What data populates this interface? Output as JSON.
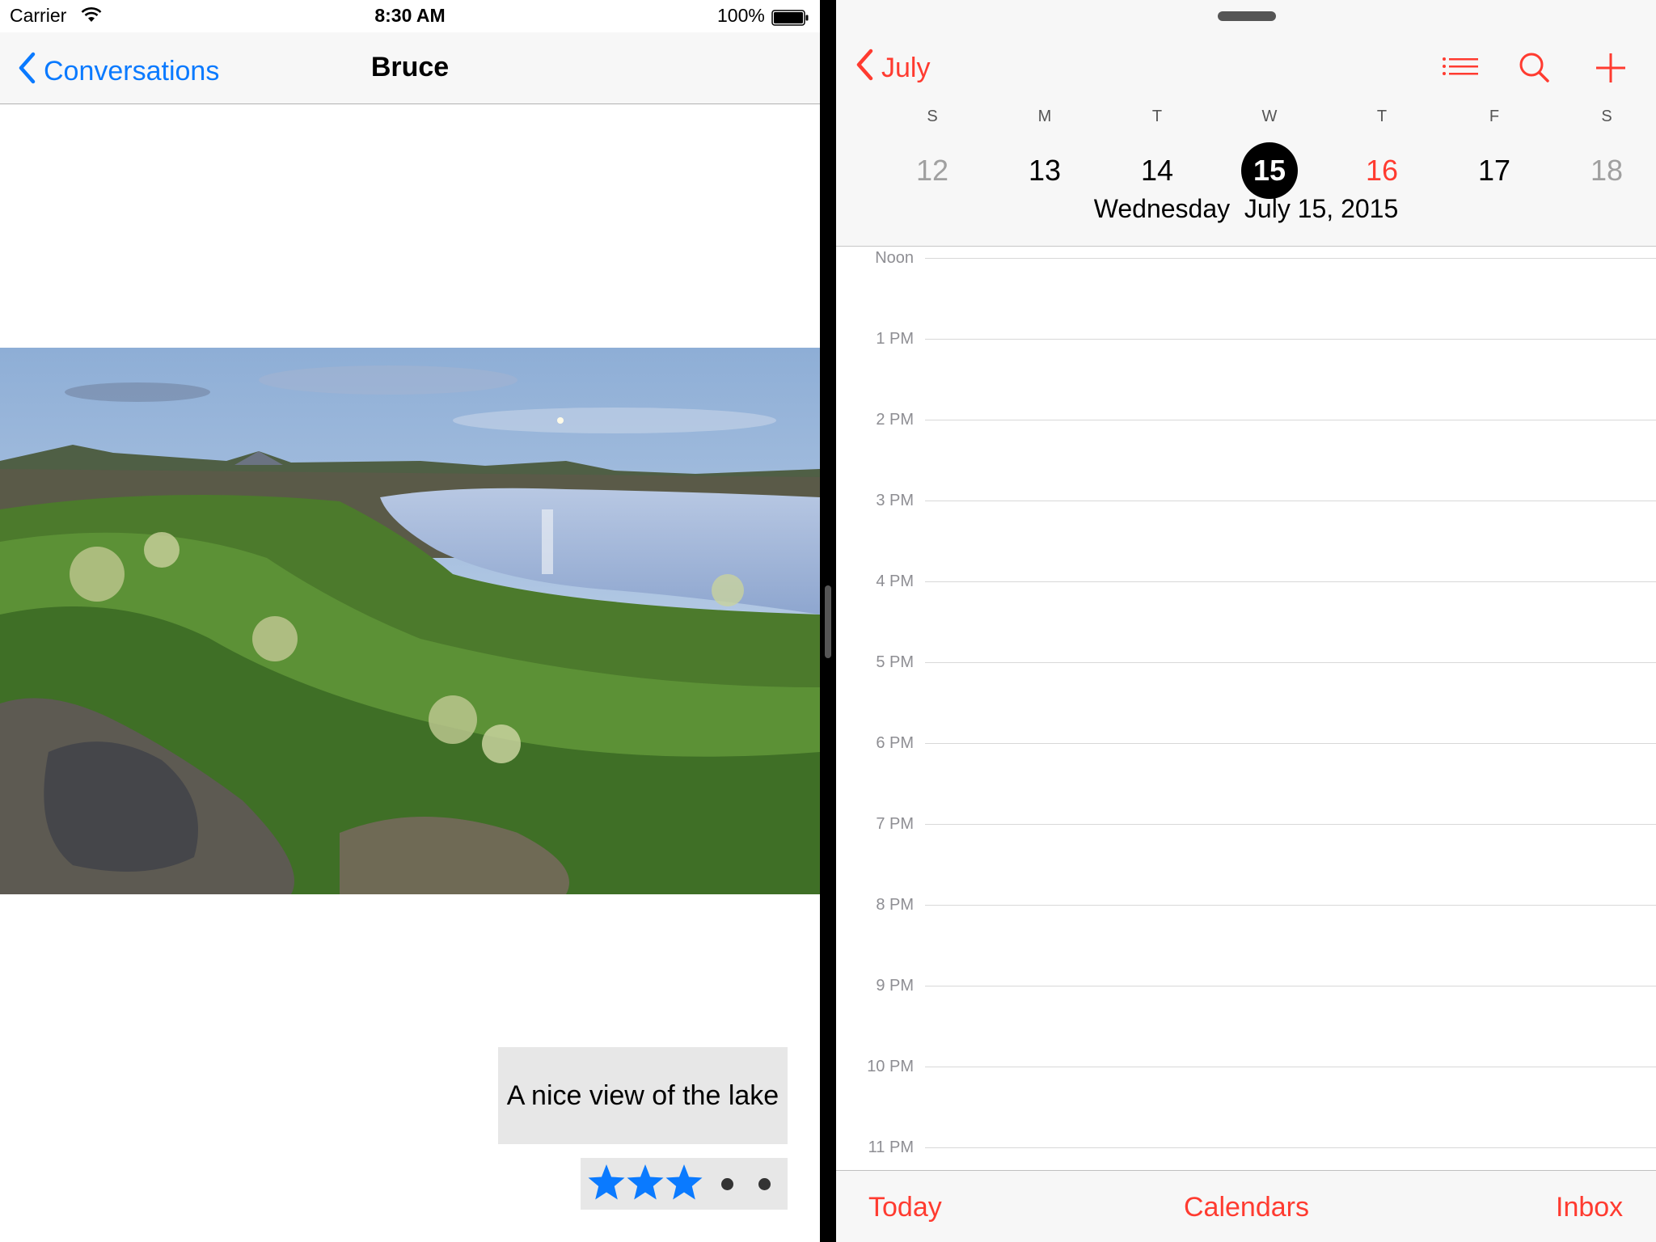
{
  "status_bar": {
    "carrier": "Carrier",
    "time": "8:30 AM",
    "battery": "100%"
  },
  "messages": {
    "back_label": "Conversations",
    "title": "Bruce",
    "caption": "A nice view of the lake",
    "rating": {
      "filled_stars": 3,
      "total": 5
    }
  },
  "calendar": {
    "month_label": "July",
    "weekday_letters": [
      "S",
      "M",
      "T",
      "W",
      "T",
      "F",
      "S"
    ],
    "days": [
      "12",
      "13",
      "14",
      "15",
      "16",
      "17",
      "18"
    ],
    "selected_day": "15",
    "weekday_name": "Wednesday",
    "full_date": "July 15, 2015",
    "hours": [
      "Noon",
      "1 PM",
      "2 PM",
      "3 PM",
      "4 PM",
      "5 PM",
      "6 PM",
      "7 PM",
      "8 PM",
      "9 PM",
      "10 PM",
      "11 PM"
    ],
    "tabs": {
      "today": "Today",
      "calendars": "Calendars",
      "inbox": "Inbox"
    }
  },
  "colors": {
    "ios_blue": "#0a7aff",
    "ios_red": "#ff3b30",
    "star_blue": "#0a7aff"
  },
  "icons": {
    "back": "chevron-left-icon",
    "list": "list-icon",
    "search": "search-icon",
    "add": "plus-icon",
    "star": "star-icon",
    "wifi": "wifi-icon",
    "battery": "battery-icon"
  }
}
